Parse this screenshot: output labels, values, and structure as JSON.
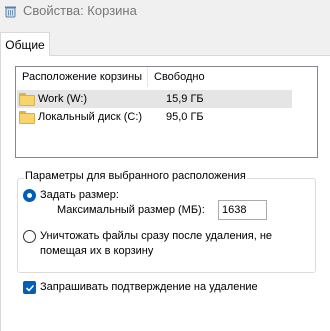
{
  "window": {
    "title": "Свойства: Корзина",
    "icon": "recycle-bin-icon"
  },
  "tabs": [
    {
      "label": "Общие",
      "active": true
    }
  ],
  "locations": {
    "headers": [
      "Расположение корзины",
      "Свободно"
    ],
    "rows": [
      {
        "name": "Work (W:)",
        "free": "15,9 ГБ",
        "selected": true,
        "icon": "folder-icon"
      },
      {
        "name": "Локальный диск (C:)",
        "free": "95,0 ГБ",
        "selected": false,
        "icon": "folder-icon"
      }
    ]
  },
  "settings": {
    "group_title": "Параметры для выбранного расположения",
    "custom_size_label": "Задать размер:",
    "custom_size_selected": true,
    "max_size_label": "Максимальный размер (МБ):",
    "max_size_value": "1638",
    "delete_immediately_label_line1": "Уничтожать файлы сразу после удаления, не",
    "delete_immediately_label_line2": "помещая их в корзину",
    "delete_immediately_selected": false
  },
  "confirm": {
    "label": "Запрашивать подтверждение на удаление",
    "checked": true
  },
  "colors": {
    "accent": "#005fb8",
    "selected_row": "#e5e5e5"
  }
}
